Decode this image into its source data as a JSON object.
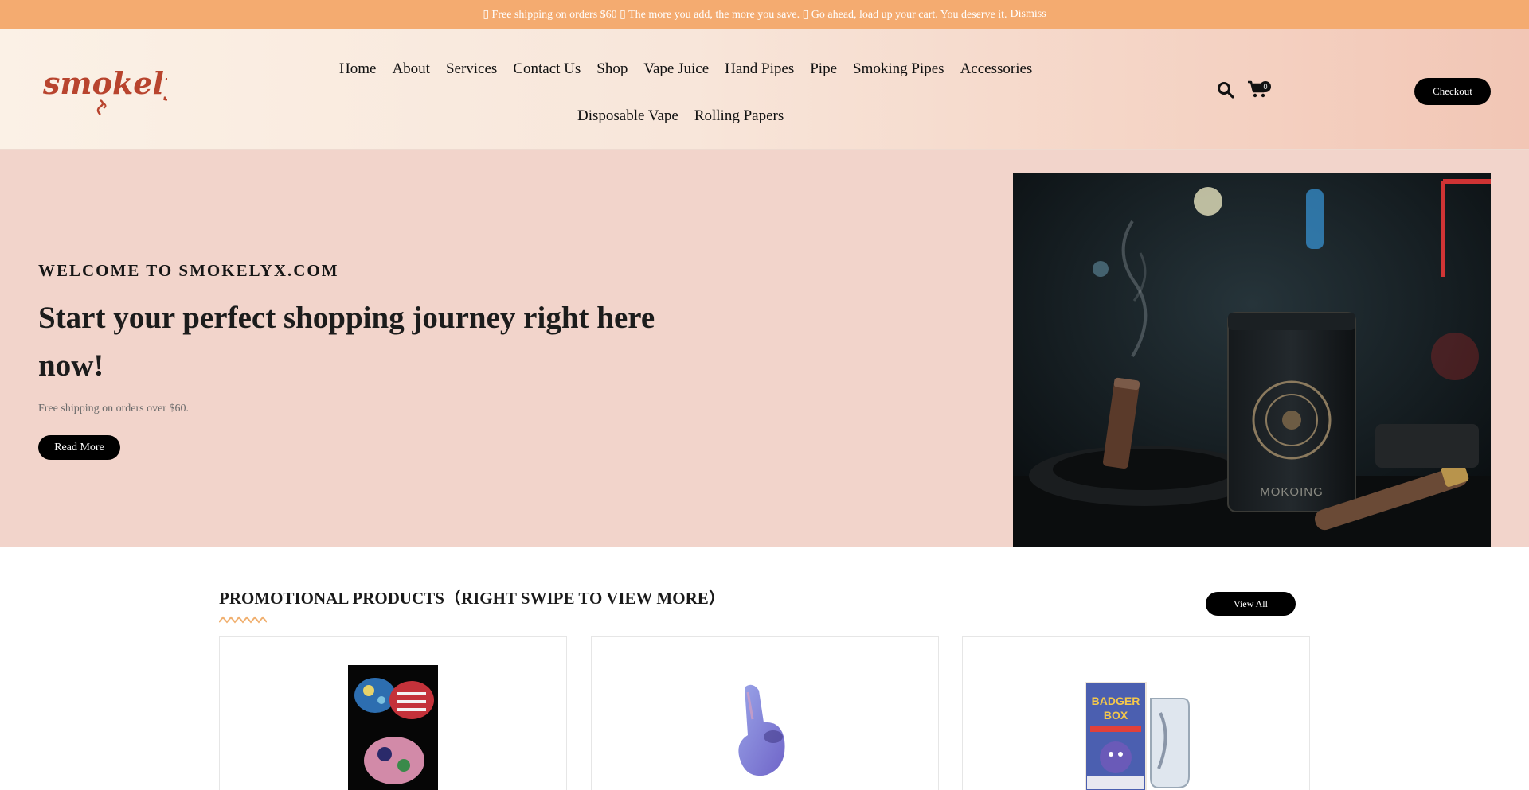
{
  "announcement": {
    "text": "▯ Free shipping on orders $60 ▯ The more you add, the more you save. ▯ Go ahead, load up your cart. You deserve it.",
    "dismiss_label": "Dismiss"
  },
  "header": {
    "logo_text": "smokelyx",
    "nav_row1": [
      "Home",
      "About",
      "Services",
      "Contact Us",
      "Shop",
      "Vape Juice",
      "Hand Pipes",
      "Pipe",
      "Smoking Pipes",
      "Accessories"
    ],
    "nav_row2": [
      "Disposable Vape",
      "Rolling Papers"
    ],
    "search_icon": "search-icon",
    "cart_icon": "cart-icon",
    "cart_count": "0",
    "checkout_label": "Checkout"
  },
  "hero": {
    "eyebrow": "WELCOME TO SMOKELYX.COM",
    "title": "Start your perfect shopping journey right here now!",
    "subtitle": "Free shipping on orders over $60.",
    "button_label": "Read More",
    "image_text": "MOKOING"
  },
  "promo": {
    "title": "PROMOTIONAL PRODUCTS（RIGHT SWIPE TO VIEW MORE）",
    "view_all_label": "View All",
    "product_box_text": [
      "BADGER",
      "BOX"
    ]
  },
  "colors": {
    "announcement_bg": "#f4ab70",
    "hero_bg": "#f2d4cb",
    "logo": "#b8442e",
    "button": "#000000"
  }
}
